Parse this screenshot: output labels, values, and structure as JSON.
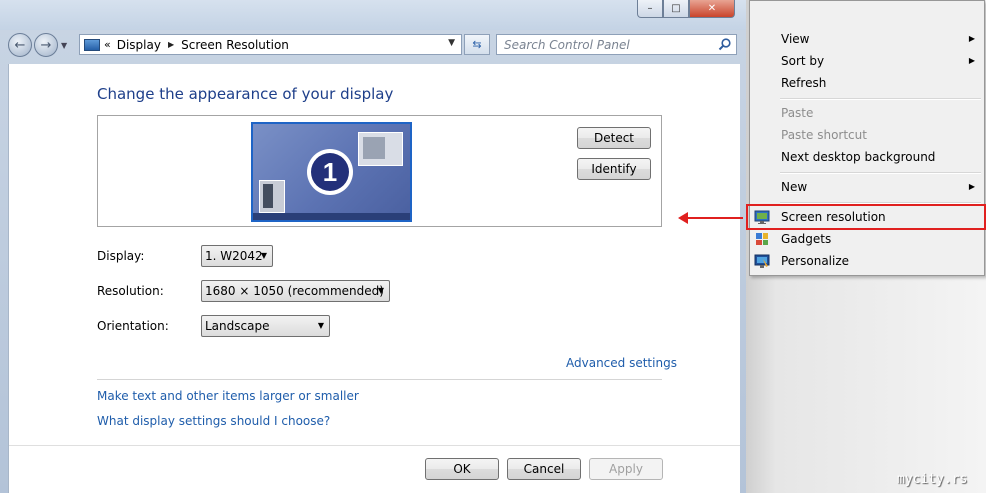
{
  "window": {
    "caption": {
      "minimize": "–",
      "maximize": "□",
      "close": "✕"
    }
  },
  "nav": {
    "back_icon": "←",
    "forward_icon": "→",
    "address_chevron": "«",
    "breadcrumb": [
      "Display",
      "Screen Resolution"
    ],
    "search_placeholder": "Search Control Panel"
  },
  "main": {
    "title": "Change the appearance of your display",
    "monitor_number": "1",
    "detect_label": "Detect",
    "identify_label": "Identify",
    "display_label": "Display:",
    "display_value": "1. W2042",
    "resolution_label": "Resolution:",
    "resolution_value": "1680 × 1050 (recommended)",
    "orientation_label": "Orientation:",
    "orientation_value": "Landscape",
    "advanced_link": "Advanced settings",
    "links": [
      "Make text and other items larger or smaller",
      "What display settings should I choose?"
    ]
  },
  "footer": {
    "ok_label": "OK",
    "cancel_label": "Cancel",
    "apply_label": "Apply"
  },
  "context_menu": {
    "items": [
      {
        "label": "View",
        "submenu": true,
        "disabled": false
      },
      {
        "label": "Sort by",
        "submenu": true,
        "disabled": false
      },
      {
        "label": "Refresh",
        "submenu": false,
        "disabled": false
      },
      {
        "label": "Paste",
        "submenu": false,
        "disabled": true
      },
      {
        "label": "Paste shortcut",
        "submenu": false,
        "disabled": true
      },
      {
        "label": "Next desktop background",
        "submenu": false,
        "disabled": false
      },
      {
        "label": "New",
        "submenu": true,
        "disabled": false
      },
      {
        "label": "Screen resolution",
        "submenu": false,
        "disabled": false,
        "icon": "screen-resolution-icon"
      },
      {
        "label": "Gadgets",
        "submenu": false,
        "disabled": false,
        "icon": "gadgets-icon"
      },
      {
        "label": "Personalize",
        "submenu": false,
        "disabled": false,
        "icon": "personalize-icon"
      }
    ]
  },
  "colors": {
    "accent_link": "#1f5dab",
    "title_blue": "#1e3f8a",
    "highlight_red": "#e0201f"
  },
  "watermark": "mycity.rs"
}
